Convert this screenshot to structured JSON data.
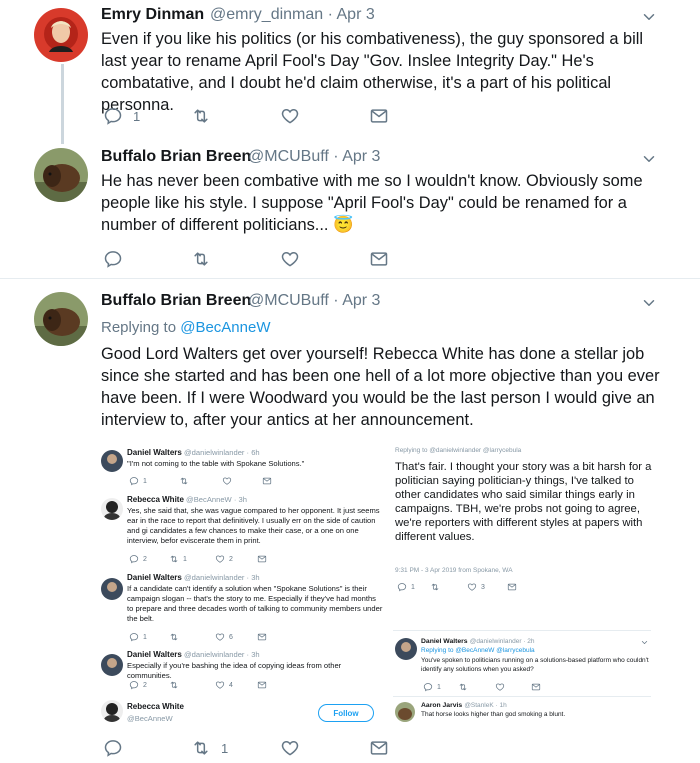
{
  "tweet1": {
    "name": "Emry Dinman",
    "handle_date": "@emry_dinman · Apr 3",
    "text": "Even if you like his politics (or his combativeness), the guy sponsored a bill last year to rename April Fool's Day \"Gov. Inslee Integrity Day.\" He's combatative, and I doubt he'd claim otherwise, it's a part of his political personna.",
    "reply_count": "1"
  },
  "tweet2": {
    "name": "Buffalo Brian Breen",
    "handle_date": "@MCUBuff · Apr 3",
    "text": "He has never been combative with me so I wouldn't know. Obviously some people like his style. I suppose \"April Fool's Day\" could be renamed for a number of different politicians...",
    "emoji": "😇"
  },
  "tweet3": {
    "name": "Buffalo Brian Breen",
    "handle_date": "@MCUBuff · Apr 3",
    "replying_prefix": "Replying to ",
    "replying_handle": "@BecAnneW",
    "text": "Good Lord Walters get over yourself! Rebecca White has done a stellar job since she started and has been one hell of a lot more objective than you ever have been. If I were Woodward you would be the last person I would give an interview to, after your antics at her announcement.",
    "retweet_count": "1"
  },
  "embed_left": {
    "t1": {
      "name": "Daniel Walters",
      "handle": "@danielwinlander · 6h",
      "text": "\"I'm not coming to the table with Spokane Solutions.\"",
      "reply": "1",
      "rt": "",
      "like": ""
    },
    "t2": {
      "name": "Rebecca White",
      "handle": "@BecAnneW · 3h",
      "text": "Yes, she said that, she was vague compared to her opponent. It just seems ear in the race to report that definitively. I usually err on the side of caution and gi candidates a few chances to make their case, or a one on one interview, befor eviscerate them in print.",
      "reply": "2",
      "rt": "1",
      "like": "2"
    },
    "t3": {
      "name": "Daniel Walters",
      "handle": "@danielwinlander · 3h",
      "text": "If a candidate can't identify a solution when \"Spokane Solutions\" is their campaign slogan -- that's the story to me. Especially if they've had months to prepare and three decades worth of talking to community members under the belt.",
      "reply": "1",
      "rt": "",
      "like": "6"
    },
    "t4": {
      "name": "Daniel Walters",
      "handle": "@danielwinlander · 3h",
      "text": "Especially if you're bashing the idea of copying ideas from other communities.",
      "reply": "2",
      "rt": "",
      "like": "4"
    },
    "profile": {
      "name": "Rebecca White",
      "handle": "@BecAnneW",
      "follow": "Follow"
    }
  },
  "embed_right": {
    "replying": "Replying to @danielwinlander @larrycebula",
    "text": "That's fair. I thought your story was a bit harsh for a  politician saying politician-y things, I've talked to other candidates who said similar things early in campaigns. TBH, we're probs not going to agree, we're reporters with different styles at papers with different values.",
    "timestamp": "9:31 PM - 3 Apr 2019 from Spokane, WA",
    "reply": "1",
    "rt": "",
    "like": "3",
    "t2": {
      "name": "Daniel Walters",
      "handle": "@danielwinlander · 2h",
      "replying": "Replying to @BecAnneW @larrycebula",
      "text": "You've spoken to politicians running on a solutions-based platform who couldn't identify any solutions when you asked?",
      "reply": "1"
    },
    "t3": {
      "name": "Aaron Jarvis",
      "handle": "@StanleK · 1h",
      "text": "That horse looks higher than god smoking a blunt."
    }
  }
}
